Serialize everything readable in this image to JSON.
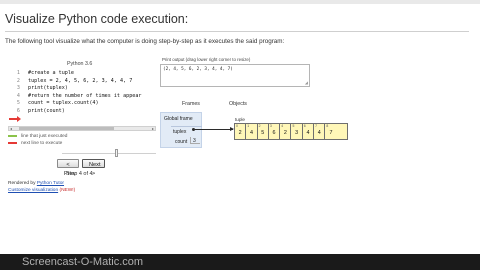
{
  "page": {
    "title": "Visualize Python code execution:",
    "intro": "The following tool visualize what the computer is doing step-by-step as it executes the said program:"
  },
  "tutor": {
    "version_label": "Python 3.6",
    "code_lines": [
      {
        "n": "1",
        "text": "#create a tuple"
      },
      {
        "n": "2",
        "text": "tuplex = 2, 4, 5, 6, 2, 3, 4, 4, 7"
      },
      {
        "n": "3",
        "text": "print(tuplex)"
      },
      {
        "n": "4",
        "text": "#return the number of times it appear"
      },
      {
        "n": "5",
        "text": "count = tuplex.count(4)"
      },
      {
        "n": "6",
        "text": "print(count)"
      }
    ],
    "scroll_left": "◂",
    "scroll_right": "▸",
    "legend_executed": "line that just executed",
    "legend_next": "next line to execute",
    "prev_button": "< Prev",
    "next_button": "Next >",
    "step_text": "Step 4 of 4",
    "rendered_prefix": "Rendered by",
    "rendered_link": "Python Tutor",
    "customize_link": "Customize visualization",
    "customize_badge": "(NEW!)",
    "colors": {
      "executed": "#8bc34a",
      "next": "#e53935"
    }
  },
  "output": {
    "label": "Print output (drag lower right corner to resize)",
    "text": "(2, 4, 5, 6, 2, 3, 4, 4, 7)",
    "grip": "◢"
  },
  "visual": {
    "frames_heading": "Frames",
    "objects_heading": "Objects",
    "frame_name": "Global frame",
    "var_tuplex": "tuplex",
    "var_count": "count",
    "count_value": "3",
    "heap_type": "tuple",
    "tuple_items": [
      {
        "i": "0",
        "v": "2"
      },
      {
        "i": "1",
        "v": "4"
      },
      {
        "i": "2",
        "v": "5"
      },
      {
        "i": "3",
        "v": "6"
      },
      {
        "i": "4",
        "v": "2"
      },
      {
        "i": "5",
        "v": "3"
      },
      {
        "i": "6",
        "v": "4"
      },
      {
        "i": "7",
        "v": "4"
      },
      {
        "i": "8",
        "v": "7"
      }
    ]
  },
  "watermark": "Screencast-O-Matic.com"
}
